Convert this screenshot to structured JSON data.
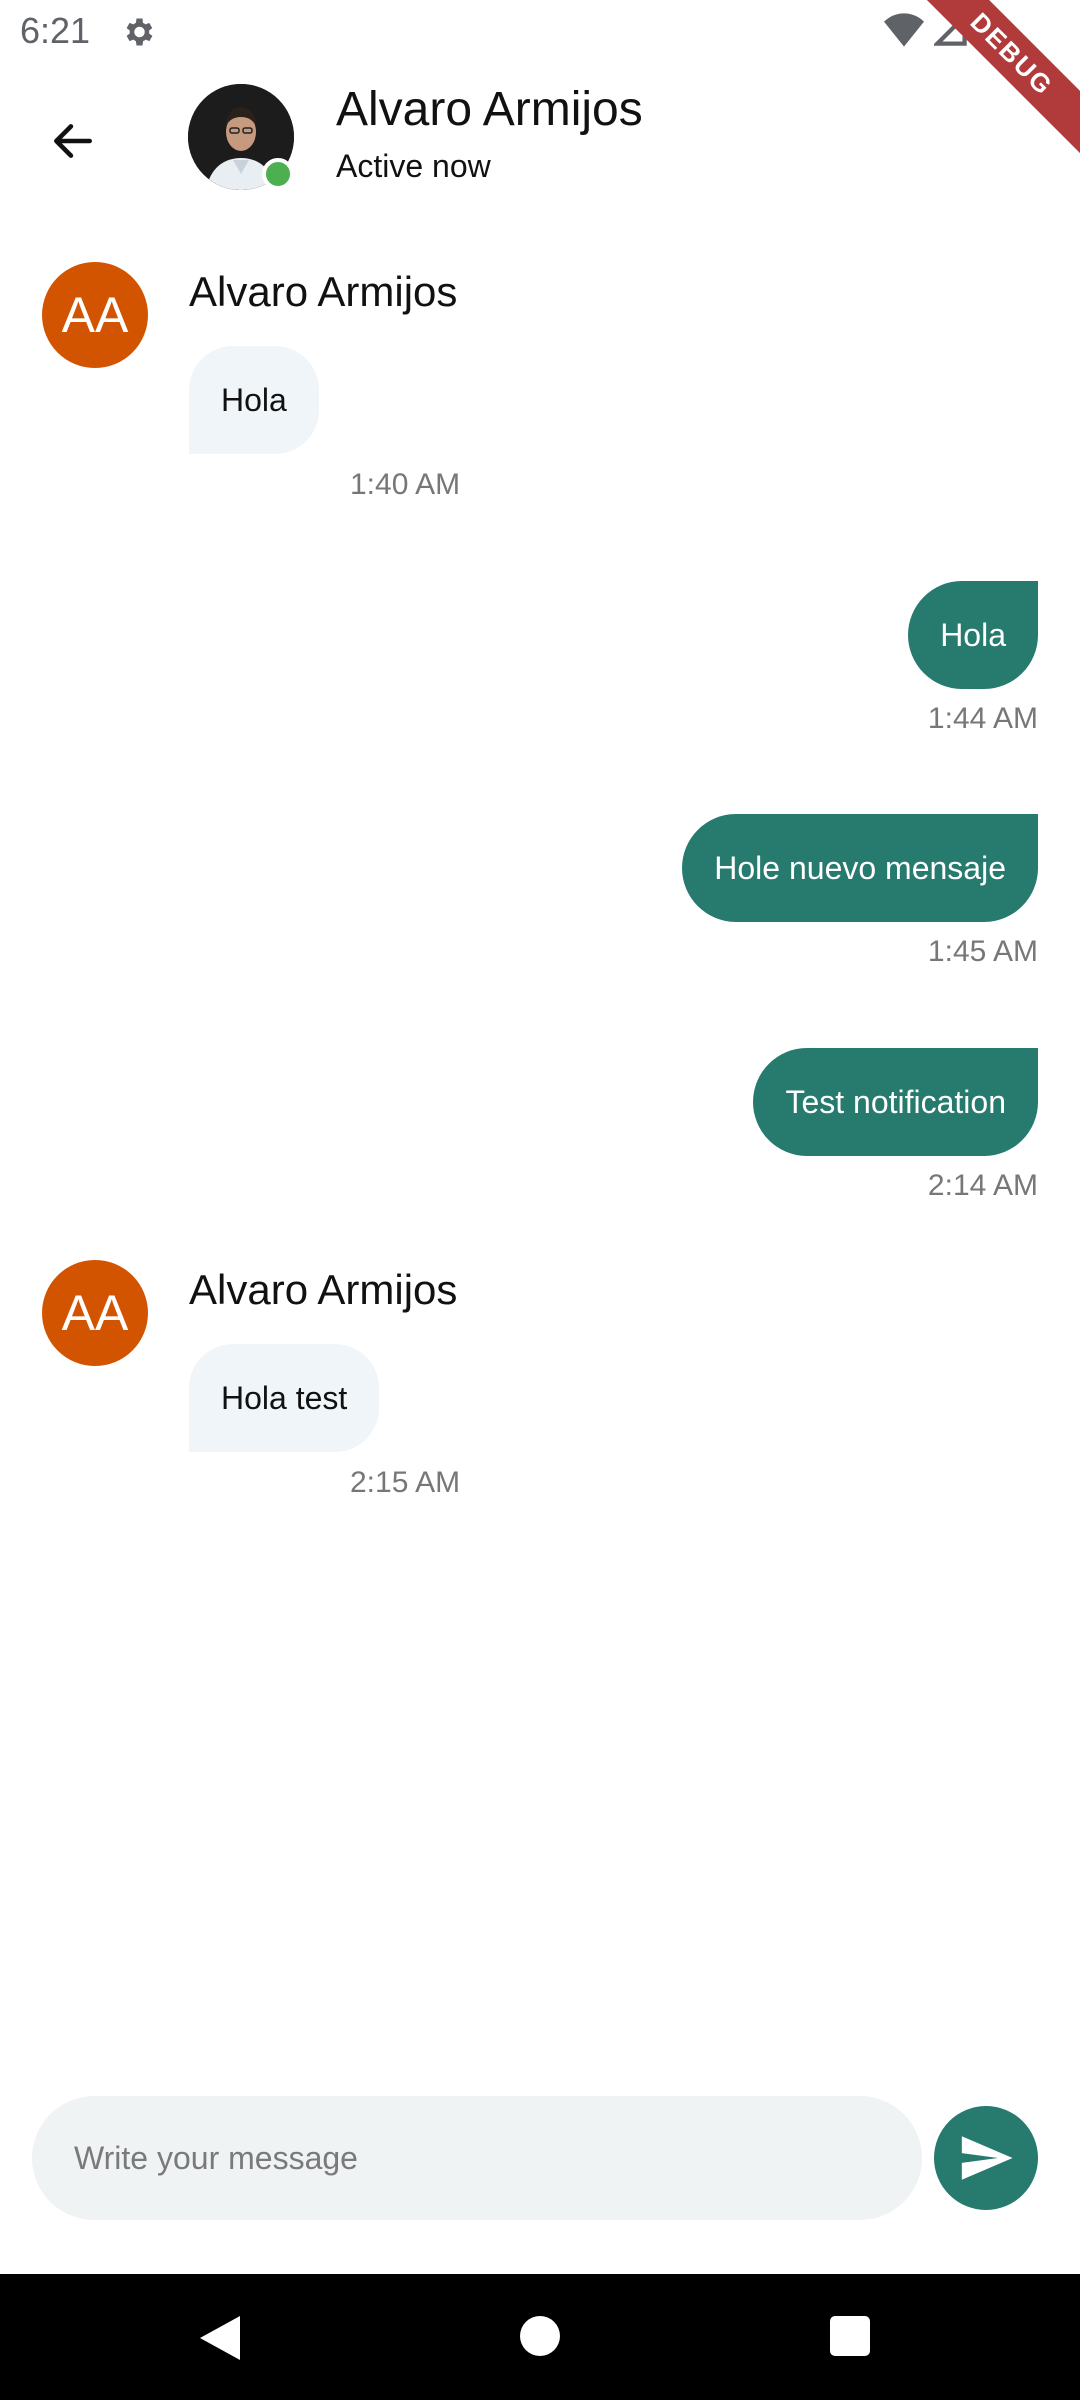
{
  "status_bar": {
    "time": "6:21",
    "debug_label": "DEBUG"
  },
  "header": {
    "name": "Alvaro Armijos",
    "status": "Active now"
  },
  "messages": {
    "m1": {
      "initials": "AA",
      "sender": "Alvaro Armijos",
      "text": "Hola",
      "time": "1:40 AM"
    },
    "m2": {
      "text": "Hola",
      "time": "1:44 AM"
    },
    "m3": {
      "text": "Hole nuevo mensaje",
      "time": "1:45 AM"
    },
    "m4": {
      "text": "Test notification",
      "time": "2:14 AM"
    },
    "m5": {
      "initials": "AA",
      "sender": "Alvaro Armijos",
      "text": "Hola test",
      "time": "2:15 AM"
    }
  },
  "composer": {
    "placeholder": "Write your message",
    "value": ""
  },
  "colors": {
    "accent": "#267a6e",
    "avatar": "#d35400",
    "online": "#4caf50",
    "incoming_bubble": "#f0f5fa"
  }
}
